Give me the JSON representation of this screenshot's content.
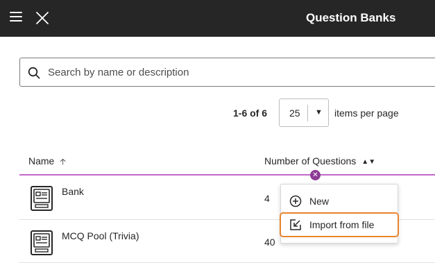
{
  "header": {
    "title": "Question Banks"
  },
  "search": {
    "placeholder": "Search by name or description",
    "value": ""
  },
  "pagination": {
    "count_text": "1-6 of 6",
    "per_page_value": "25",
    "per_page_label": "items per page"
  },
  "table": {
    "headers": {
      "name": "Name",
      "count": "Number of Questions"
    },
    "rows": [
      {
        "name": "Bank",
        "count": "4"
      },
      {
        "name": "MCQ Pool (Trivia)",
        "count": "40"
      }
    ]
  },
  "add_menu": {
    "items": [
      {
        "label": "New",
        "icon": "plus-circle-icon"
      },
      {
        "label": "Import from file",
        "icon": "import-file-icon"
      }
    ]
  },
  "colors": {
    "header_bg": "#262626",
    "accent_purple": "#c267c8",
    "focus_orange": "#e8832c"
  }
}
